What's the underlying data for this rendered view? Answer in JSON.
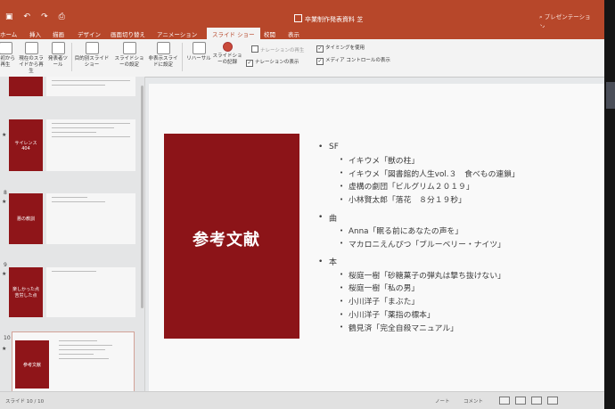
{
  "titlebar": {
    "doc_title": "卒業制作発表資料  芝",
    "tell_me": "プレゼンテーション…"
  },
  "qat_icons": [
    "save-icon",
    "undo-icon",
    "redo-icon",
    "print-icon"
  ],
  "tabs": [
    {
      "label": "ホーム",
      "active": false
    },
    {
      "label": "挿入",
      "active": false
    },
    {
      "label": "描画",
      "active": false
    },
    {
      "label": "デザイン",
      "active": false
    },
    {
      "label": "画面切り替え",
      "active": false
    },
    {
      "label": "アニメーション",
      "active": false
    },
    {
      "label": "スライド ショー",
      "active": true
    },
    {
      "label": "校閲",
      "active": false
    },
    {
      "label": "表示",
      "active": false
    }
  ],
  "ribbon": {
    "buttons": [
      {
        "label": "最初から再生"
      },
      {
        "label": "現在のスライドから再生"
      },
      {
        "label": "発表者ツール"
      },
      {
        "label": "目的別スライドショー"
      },
      {
        "label": "スライドショーの設定"
      },
      {
        "label": "非表示スライドに設定"
      },
      {
        "label": "リハーサル"
      },
      {
        "label": "スライドショーの記録"
      }
    ],
    "checks": [
      {
        "label": "ナレーションの再生",
        "checked": true
      },
      {
        "label": "タイミングを使用",
        "checked": true
      },
      {
        "label": "メディア コントロールの表示",
        "checked": true
      },
      {
        "label": "ナレーションの表示",
        "checked": false
      }
    ]
  },
  "thumbnails": [
    {
      "num": "",
      "title": ""
    },
    {
      "num": "",
      "title": "サイレンス 404"
    },
    {
      "num": "8",
      "title": "悪の教訓"
    },
    {
      "num": "9",
      "title": "楽しかった点 苦労した点"
    },
    {
      "num": "10",
      "title": "参考文献"
    }
  ],
  "slide": {
    "title": "参考文献",
    "sections": [
      {
        "heading": "SF",
        "items": [
          "イキウメ「獣の柱」",
          "イキウメ「図書館的人生vol.３　食べもの連鎖」",
          "虚構の劇団「ビルグリム２０１９」",
          "小林賢太郎「落花　８分１９秒」"
        ]
      },
      {
        "heading": "曲",
        "items": [
          "Anna「眠る前にあなたの声を」",
          "マカロニえんぴつ「ブルーベリー・ナイツ」"
        ]
      },
      {
        "heading": "本",
        "items": [
          "桜庭一樹「砂糖菓子の弾丸は撃ち抜けない」",
          "桜庭一樹「私の男」",
          "小川洋子「まぶた」",
          "小川洋子「薬指の標本」",
          "鶴見済「完全自殺マニュアル」"
        ]
      }
    ]
  },
  "status": {
    "slide_info": "スライド 10 / 10",
    "notes": "ノート",
    "comments": "コメント"
  },
  "colors": {
    "accent": "#b7472a",
    "slide_block": "#8c1418"
  }
}
